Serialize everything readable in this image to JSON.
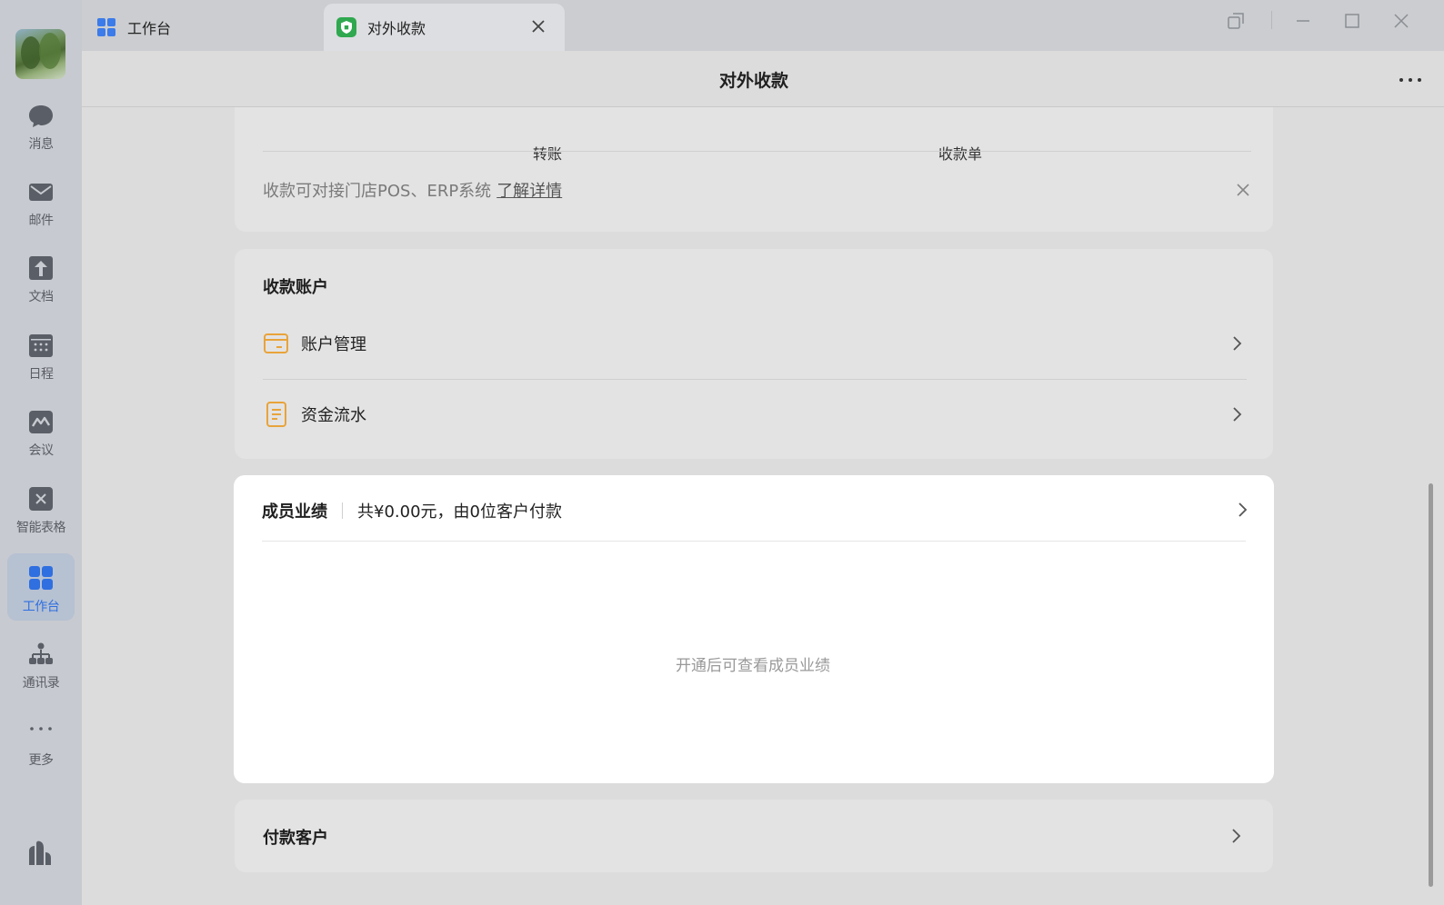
{
  "sidebar": {
    "items": [
      {
        "label": "消息",
        "icon": "chat-bubble-icon"
      },
      {
        "label": "邮件",
        "icon": "mail-icon"
      },
      {
        "label": "文档",
        "icon": "document-icon"
      },
      {
        "label": "日程",
        "icon": "calendar-icon"
      },
      {
        "label": "会议",
        "icon": "meeting-icon"
      },
      {
        "label": "智能表格",
        "icon": "smart-table-icon"
      },
      {
        "label": "工作台",
        "icon": "workbench-grid-icon",
        "active": true
      },
      {
        "label": "通讯录",
        "icon": "contacts-tree-icon"
      },
      {
        "label": "更多",
        "icon": "more-dots-icon"
      }
    ]
  },
  "tabs": [
    {
      "label": "工作台",
      "icon": "workbench-grid-icon"
    },
    {
      "label": "对外收款",
      "icon": "shield-app-icon",
      "active": true
    }
  ],
  "header": {
    "title": "对外收款"
  },
  "top_card": {
    "cut_labels": [
      "转账",
      "收款单"
    ],
    "notice_text": "收款可对接门店POS、ERP系统",
    "notice_link": "了解详情"
  },
  "accounts": {
    "title": "收款账户",
    "items": [
      {
        "label": "账户管理",
        "icon": "account-card-icon"
      },
      {
        "label": "资金流水",
        "icon": "ledger-doc-icon"
      }
    ]
  },
  "performance": {
    "title": "成员业绩",
    "summary": "共¥0.00元，由0位客户付款",
    "empty": "开通后可查看成员业绩"
  },
  "customers": {
    "title": "付款客户"
  },
  "colors": {
    "accent": "#2f6fe0",
    "icon_orange": "#e8a33a",
    "tab_green": "#2fa84f"
  }
}
